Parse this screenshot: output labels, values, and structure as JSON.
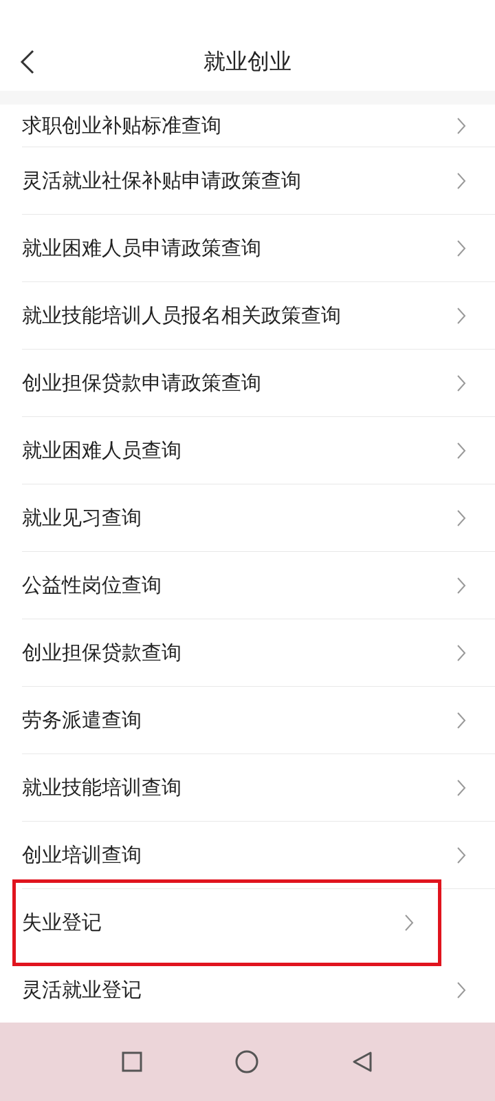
{
  "header": {
    "title": "就业创业"
  },
  "items": [
    {
      "label": "求职创业补贴标准查询",
      "highlighted": false
    },
    {
      "label": "灵活就业社保补贴申请政策查询",
      "highlighted": false
    },
    {
      "label": "就业困难人员申请政策查询",
      "highlighted": false
    },
    {
      "label": "就业技能培训人员报名相关政策查询",
      "highlighted": false
    },
    {
      "label": "创业担保贷款申请政策查询",
      "highlighted": false
    },
    {
      "label": "就业困难人员查询",
      "highlighted": false
    },
    {
      "label": "就业见习查询",
      "highlighted": false
    },
    {
      "label": "公益性岗位查询",
      "highlighted": false
    },
    {
      "label": "创业担保贷款查询",
      "highlighted": false
    },
    {
      "label": "劳务派遣查询",
      "highlighted": false
    },
    {
      "label": "就业技能培训查询",
      "highlighted": false
    },
    {
      "label": "创业培训查询",
      "highlighted": false
    },
    {
      "label": "失业登记",
      "highlighted": true
    },
    {
      "label": "灵活就业登记",
      "highlighted": false
    }
  ]
}
